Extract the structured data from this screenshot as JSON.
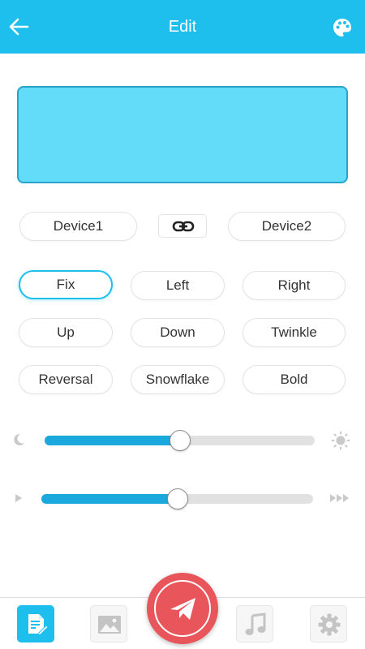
{
  "header": {
    "title": "Edit",
    "back_icon": "arrow-left-icon",
    "palette_icon": "palette-icon",
    "background_color": "#1ebeed"
  },
  "preview": {
    "fill_color": "#62dcf8",
    "border_color": "#2aa3cc"
  },
  "devices": {
    "device1_label": "Device1",
    "device2_label": "Device2",
    "link_icon": "link-icon"
  },
  "effects": {
    "selected": "Fix",
    "row1": [
      "Fix",
      "Left",
      "Right"
    ],
    "row2": [
      "Up",
      "Down",
      "Twinkle"
    ],
    "row3": [
      "Reversal",
      "Snowflake",
      "Bold"
    ]
  },
  "sliders": {
    "brightness": {
      "value_percent": 50,
      "min_icon": "moon-icon",
      "max_icon": "sun-icon"
    },
    "speed": {
      "value_percent": 50,
      "min_icon": "play-icon",
      "max_icon": "fast-forward-icon"
    }
  },
  "bottom_nav": {
    "items": [
      {
        "icon": "edit-document-icon",
        "active": true
      },
      {
        "icon": "image-icon",
        "active": false
      },
      {
        "icon": "send-icon",
        "center": true
      },
      {
        "icon": "music-icon",
        "active": false
      },
      {
        "icon": "gear-icon",
        "active": false
      }
    ],
    "active_color": "#1ebeed",
    "send_color": "#e8555a"
  }
}
